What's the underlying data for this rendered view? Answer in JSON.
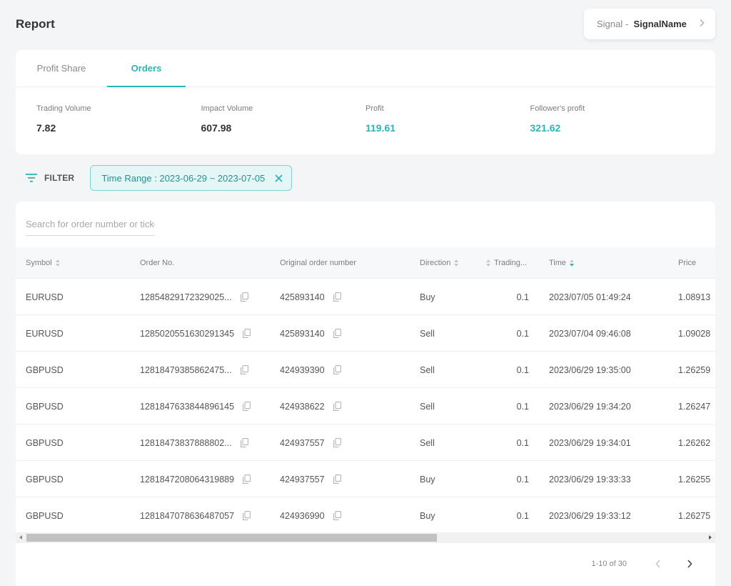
{
  "header": {
    "title": "Report",
    "signal_prefix": "Signal",
    "signal_dash": "-",
    "signal_name": "SignalName"
  },
  "tabs": [
    {
      "label": "Profit Share",
      "active": false
    },
    {
      "label": "Orders",
      "active": true
    }
  ],
  "stats": [
    {
      "label": "Trading Volume",
      "value": "7.82"
    },
    {
      "label": "Impact Volume",
      "value": "607.98"
    },
    {
      "label": "Profit",
      "value": "119.61"
    },
    {
      "label": "Follower's profit",
      "value": "321.62"
    }
  ],
  "filter": {
    "label": "FILTER",
    "chip": "Time Range : 2023-06-29 ~ 2023-07-05"
  },
  "search": {
    "placeholder": "Search for order number or ticket"
  },
  "table": {
    "columns": {
      "symbol": "Symbol",
      "order_no": "Order No.",
      "original": "Original order number",
      "direction": "Direction",
      "trading": "Trading...",
      "time": "Time",
      "price": "Price"
    },
    "rows": [
      {
        "symbol": "EURUSD",
        "order_no": "12854829172329025...",
        "original": "425893140",
        "direction": "Buy",
        "trading": "0.1",
        "time": "2023/07/05 01:49:24",
        "price": "1.08913"
      },
      {
        "symbol": "EURUSD",
        "order_no": "1285020551630291345",
        "original": "425893140",
        "direction": "Sell",
        "trading": "0.1",
        "time": "2023/07/04 09:46:08",
        "price": "1.09028"
      },
      {
        "symbol": "GBPUSD",
        "order_no": "12818479385862475...",
        "original": "424939390",
        "direction": "Sell",
        "trading": "0.1",
        "time": "2023/06/29 19:35:00",
        "price": "1.26259"
      },
      {
        "symbol": "GBPUSD",
        "order_no": "1281847633844896145",
        "original": "424938622",
        "direction": "Sell",
        "trading": "0.1",
        "time": "2023/06/29 19:34:20",
        "price": "1.26247"
      },
      {
        "symbol": "GBPUSD",
        "order_no": "12818473837888802...",
        "original": "424937557",
        "direction": "Sell",
        "trading": "0.1",
        "time": "2023/06/29 19:34:01",
        "price": "1.26262"
      },
      {
        "symbol": "GBPUSD",
        "order_no": "1281847208064319889",
        "original": "424937557",
        "direction": "Buy",
        "trading": "0.1",
        "time": "2023/06/29 19:33:33",
        "price": "1.26255"
      },
      {
        "symbol": "GBPUSD",
        "order_no": "1281847078636487057",
        "original": "424936990",
        "direction": "Buy",
        "trading": "0.1",
        "time": "2023/06/29 19:33:12",
        "price": "1.26275"
      }
    ]
  },
  "pagination": {
    "range": "1-10 of 30"
  },
  "colors": {
    "accent": "#2bb5b5",
    "chip_bg": "#e4f6f6",
    "page_bg": "#f4f5f7"
  },
  "icons": {
    "signal_chevron": "chevron-right-icon",
    "filter": "filter-lines-icon",
    "chip_close": "close-icon",
    "copy": "copy-icon",
    "prev": "chevron-left-icon",
    "next": "chevron-right-icon"
  }
}
